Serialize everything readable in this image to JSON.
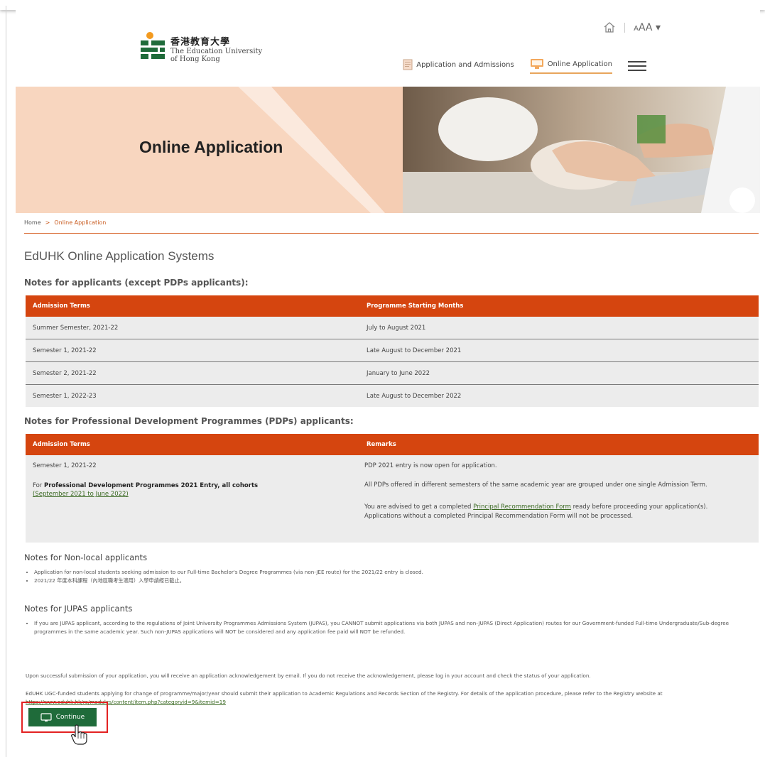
{
  "header": {
    "logo_zh": "香港教育大學",
    "logo_en_1": "The Education University",
    "logo_en_2": "of Hong Kong",
    "font_size_label": "AA",
    "nav": [
      {
        "label": "Application and Admissions",
        "icon": "document-icon"
      },
      {
        "label": "Online Application",
        "icon": "monitor-icon",
        "active": true
      }
    ]
  },
  "banner": {
    "title": "Online Application"
  },
  "breadcrumb": {
    "home": "Home",
    "sep": ">",
    "current": "Online Application"
  },
  "page_title": "EdUHK Online Application Systems",
  "section1": {
    "heading": "Notes for applicants (except PDPs applicants):",
    "headers": [
      "Admission Terms",
      "Programme Starting Months"
    ],
    "rows": [
      [
        "Summer Semester, 2021-22",
        "July to August 2021"
      ],
      [
        "Semester 1, 2021-22",
        "Late August to December 2021"
      ],
      [
        "Semester 2, 2021-22",
        "January to June 2022"
      ],
      [
        "Semester 1, 2022-23",
        "Late August to December 2022"
      ]
    ]
  },
  "section2": {
    "heading": "Notes for Professional Development Programmes (PDPs) applicants:",
    "headers": [
      "Admission Terms",
      "Remarks"
    ],
    "row1_term": "Semester 1, 2021-22",
    "row1_remark": "PDP 2021 entry is now open for application.",
    "row2_term_prefix": "For ",
    "row2_term_bold": "Professional Development Programmes 2021 Entry, all cohorts",
    "row2_term_link": "(September 2021 to June 2022)",
    "row2_remark": "All PDPs offered in different semesters of the same academic year are grouped under one single Admission Term.",
    "advise_prefix": "You are advised to get a completed ",
    "advise_link": "Principal Recommendation Form",
    "advise_suffix": " ready before proceeding your application(s).",
    "advise_line2": "Applications without a completed Principal Recommendation Form will not be processed."
  },
  "section3": {
    "heading": "Notes for Non-local applicants",
    "items": [
      "Application for non-local students seeking admission to our Full-time Bachelor's Degree Programmes (via non-JEE route) for the 2021/22 entry is closed.",
      "2021/22 年度本科課程（內地區職考生適用）入學申請經已截止。"
    ]
  },
  "section4": {
    "heading": "Notes for JUPAS applicants",
    "items": [
      "If you are JUPAS applicant, according to the regulations of Joint University Programmes Admissions System (JUPAS), you CANNOT submit applications via both JUPAS and non-JUPAS (Direct Application) routes for our Government-funded Full-time Undergraduate/Sub-degree programmes in the same academic year. Such non-JUPAS applications will NOT be considered and any application fee paid will NOT be refunded."
    ]
  },
  "para1": "Upon successful submission of your application, you will receive an application acknowledgement by email. If you do not receive the acknowledgement, please log in your account and check the status of your application.",
  "para2": "EdUHK UGC-funded students applying for change of programme/major/year should submit their application to Academic Regulations and Records Section of the Registry. For details of the application procedure, please refer to the Registry website at",
  "para2_link": "https://www.eduhk.hk/re/modules/content/item.php?categoryid=9&itemid=19",
  "continue_button": {
    "label": "Continue",
    "icon": "monitor-icon"
  },
  "colors": {
    "accent_orange": "#d5450f",
    "button_green": "#1f6b3a",
    "highlight_red": "#e32222"
  }
}
